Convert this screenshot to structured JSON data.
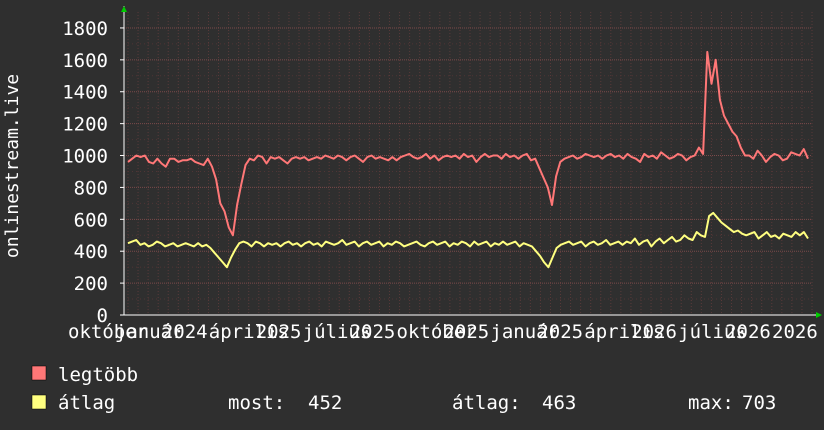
{
  "chart_data": {
    "type": "line",
    "ylabel": "onlinestream.live",
    "ylim": [
      0,
      1900
    ],
    "yticks": [
      0,
      200,
      400,
      600,
      800,
      1000,
      1200,
      1400,
      1600,
      1800
    ],
    "grid": true,
    "x_tick_labels": [
      "október",
      "január",
      "2024",
      "április",
      "2025",
      "július",
      "2025",
      "október",
      "2025",
      "január",
      "2025",
      "április",
      "2026",
      "július",
      "2026",
      "2026"
    ],
    "series": [
      {
        "name": "legtöbb",
        "color": "#ff7777",
        "values": [
          960,
          980,
          1000,
          990,
          1000,
          960,
          950,
          980,
          950,
          930,
          980,
          980,
          960,
          970,
          970,
          980,
          960,
          950,
          940,
          980,
          930,
          850,
          700,
          650,
          550,
          500,
          690,
          820,
          940,
          980,
          970,
          1000,
          990,
          950,
          990,
          980,
          990,
          970,
          950,
          980,
          990,
          980,
          990,
          970,
          980,
          990,
          980,
          1000,
          990,
          980,
          1000,
          990,
          970,
          990,
          1000,
          980,
          960,
          990,
          1000,
          980,
          990,
          980,
          970,
          990,
          970,
          990,
          1000,
          1010,
          990,
          980,
          990,
          1010,
          980,
          1000,
          970,
          990,
          1000,
          990,
          1000,
          980,
          1010,
          990,
          1000,
          960,
          990,
          1010,
          990,
          1000,
          1000,
          980,
          1010,
          990,
          1000,
          980,
          1000,
          1010,
          970,
          980,
          920,
          860,
          800,
          690,
          870,
          960,
          980,
          990,
          1000,
          980,
          990,
          1010,
          1000,
          990,
          1000,
          980,
          1000,
          1010,
          990,
          1000,
          980,
          1010,
          990,
          980,
          960,
          1010,
          990,
          1000,
          980,
          1020,
          1000,
          980,
          990,
          1010,
          1000,
          970,
          990,
          1000,
          1050,
          1010,
          1650,
          1450,
          1600,
          1350,
          1250,
          1200,
          1150,
          1120,
          1050,
          1000,
          1000,
          980,
          1030,
          1000,
          960,
          990,
          1010,
          1000,
          970,
          980,
          1020,
          1010,
          1000,
          1040,
          980
        ]
      },
      {
        "name": "átlag",
        "color": "#ffff80",
        "values": [
          450,
          460,
          470,
          440,
          450,
          430,
          440,
          460,
          450,
          430,
          440,
          450,
          430,
          440,
          450,
          440,
          430,
          450,
          430,
          440,
          420,
          390,
          360,
          330,
          300,
          360,
          410,
          450,
          460,
          450,
          430,
          460,
          450,
          430,
          450,
          440,
          450,
          430,
          450,
          460,
          440,
          450,
          430,
          450,
          460,
          440,
          450,
          430,
          460,
          450,
          440,
          450,
          470,
          440,
          450,
          460,
          430,
          450,
          460,
          440,
          450,
          460,
          430,
          450,
          440,
          460,
          450,
          430,
          440,
          450,
          460,
          440,
          430,
          450,
          460,
          440,
          450,
          460,
          430,
          450,
          440,
          460,
          450,
          430,
          460,
          440,
          450,
          460,
          430,
          450,
          440,
          460,
          440,
          450,
          460,
          430,
          450,
          440,
          430,
          400,
          370,
          330,
          300,
          360,
          420,
          440,
          450,
          460,
          440,
          450,
          460,
          430,
          450,
          460,
          440,
          450,
          470,
          440,
          450,
          460,
          440,
          460,
          450,
          480,
          440,
          460,
          470,
          430,
          460,
          480,
          450,
          470,
          490,
          460,
          470,
          500,
          480,
          470,
          520,
          500,
          490,
          620,
          640,
          610,
          580,
          560,
          540,
          520,
          530,
          510,
          500,
          510,
          520,
          480,
          500,
          520,
          490,
          500,
          480,
          510,
          500,
          490,
          520,
          500,
          520,
          480
        ]
      }
    ],
    "legend": [
      {
        "label": "legtöbb",
        "color": "#ff7777"
      },
      {
        "label": "átlag",
        "color": "#ffff80"
      }
    ],
    "stats": {
      "most_label": "most:",
      "most_value": "452",
      "atlag_label": "átlag:",
      "atlag_value": "463",
      "max_label": "max:",
      "max_value": "703"
    }
  }
}
